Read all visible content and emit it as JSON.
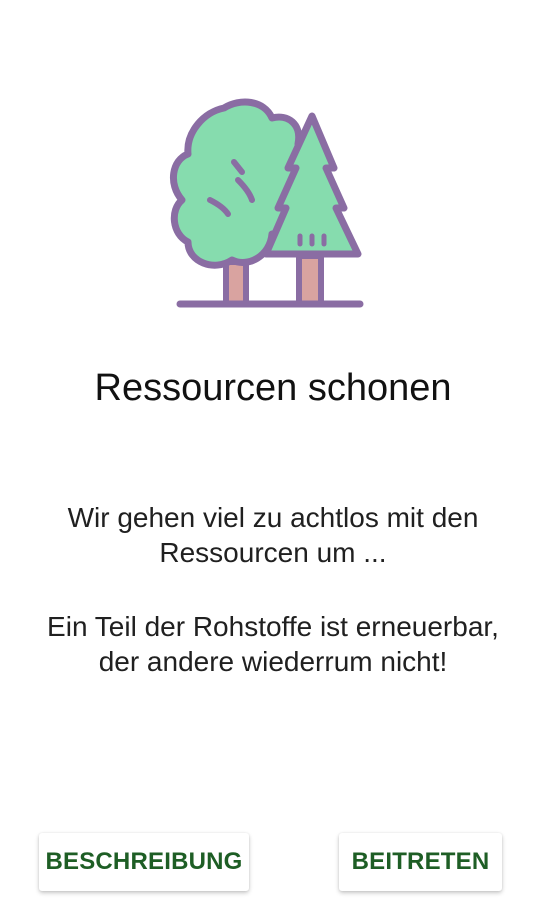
{
  "screen": {
    "title": "Ressourcen schonen",
    "description_paragraphs": [
      "Wir gehen viel zu achtlos mit den Ressourcen um ...",
      "Ein Teil der Rohstoffe ist erneuerbar, der andere wiederrum nicht!"
    ],
    "illustration_icon": "trees-icon"
  },
  "actions": {
    "description_label": "BESCHREIBUNG",
    "join_label": "BEITRETEN"
  },
  "colors": {
    "button_text": "#1e5e25",
    "tree_fill": "#86dcae",
    "tree_outline": "#8a6da3",
    "trunk": "#d9a3a0"
  }
}
